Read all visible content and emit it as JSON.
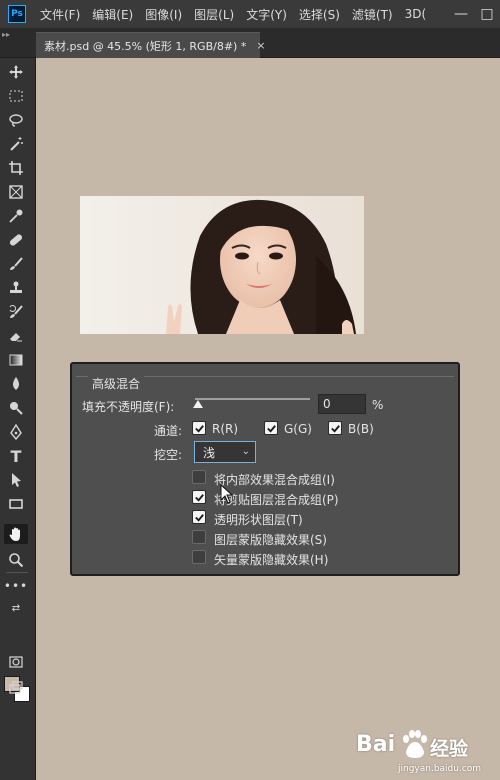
{
  "app": {
    "logo": "Ps"
  },
  "menu": [
    "文件(F)",
    "编辑(E)",
    "图像(I)",
    "图层(L)",
    "文字(Y)",
    "选择(S)",
    "滤镜(T)",
    "3D("
  ],
  "window_controls": {
    "minimize": "—",
    "restore": "□"
  },
  "tab": {
    "title": "素材.psd @ 45.5% (矩形 1, RGB/8#) *",
    "close": "×"
  },
  "tools": [
    "move-icon",
    "marquee-icon",
    "lasso-icon",
    "magic-wand-icon",
    "crop-icon",
    "frame-icon",
    "eyedropper-icon",
    "healing-brush-icon",
    "brush-icon",
    "clone-stamp-icon",
    "history-brush-icon",
    "eraser-icon",
    "gradient-icon",
    "blur-icon",
    "dodge-icon",
    "pen-icon",
    "type-icon",
    "path-selection-icon",
    "rectangle-icon",
    "hand-icon",
    "zoom-icon",
    "more-tools-icon"
  ],
  "colors": {
    "foreground": "#c9b9a8",
    "background": "#ffffff",
    "canvas": "#c6b8a8",
    "dialog": "#4f4f4f"
  },
  "dialog": {
    "title": "高级混合",
    "fill_opacity_label": "填充不透明度(F):",
    "fill_opacity_value": "0",
    "fill_opacity_unit": "%",
    "channels_label": "通道:",
    "channels": [
      {
        "label": "R(R)",
        "checked": true
      },
      {
        "label": "G(G)",
        "checked": true
      },
      {
        "label": "B(B)",
        "checked": true
      }
    ],
    "knockout_label": "挖空:",
    "knockout_value": "浅",
    "options": [
      {
        "label": "将内部效果混合成组(I)",
        "checked": false
      },
      {
        "label": "将剪贴图层混合成组(P)",
        "checked": true
      },
      {
        "label": "透明形状图层(T)",
        "checked": true
      },
      {
        "label": "图层蒙版隐藏效果(S)",
        "checked": false
      },
      {
        "label": "矢量蒙版隐藏效果(H)",
        "checked": false
      }
    ]
  },
  "watermark": {
    "brand": "Bai",
    "brand_suffix": "经验",
    "url": "jingyan.baidu.com"
  }
}
